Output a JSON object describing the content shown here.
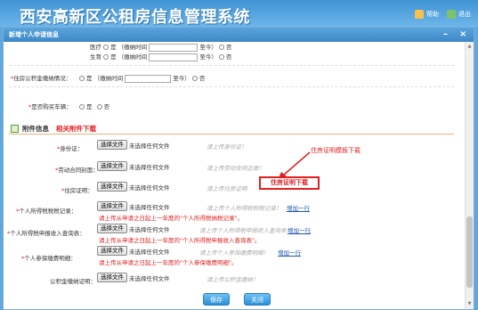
{
  "header": {
    "title": "西安高新区公租房信息管理系统",
    "help": "帮助",
    "logout": "退出"
  },
  "dialog": {
    "title": "新增个人申请信息",
    "minimize": "–",
    "close": "×"
  },
  "top_rows": [
    {
      "label": "医疗",
      "yes": "是",
      "since": "（缴纳时间",
      "until": "至今）",
      "no": "否"
    },
    {
      "label": "生育",
      "yes": "是",
      "since": "（缴纳时间",
      "until": "至今）",
      "no": "否"
    }
  ],
  "housing_fund": {
    "label": "住房公积金缴纳情况：",
    "yes": "是",
    "since": "（缴纳时间",
    "until": "至今）",
    "no": "否"
  },
  "car": {
    "label": "是否购买车辆：",
    "yes": "是",
    "no": "否"
  },
  "attachments": {
    "section_title": "附件信息",
    "download_link": "相关附件下载",
    "choose_file": "选择文件",
    "no_file": "未选择任何文件",
    "add_row": "增加一行",
    "rows": [
      {
        "label": "身份证：",
        "hint": "请上传身份证！"
      },
      {
        "label": "劳动合同封面：",
        "hint": "请上传劳动合同正面！"
      },
      {
        "label": "住房证明：",
        "hint": "请上传住房证明"
      },
      {
        "label": "个人所得税税税记录：",
        "hint": "请上传个人所得税税税记录！",
        "note": "请上传从申请之日起上一年度的\"个人所得税纳税记录\"。"
      },
      {
        "label": "个人所得税申报收入查询表：",
        "hint": "请上传个人所得税申报收入查询表！",
        "note": "请上传从申请之日起上一年度的\"个人所得税申报收入查询表\"。"
      },
      {
        "label": "个人参保缴费明细：",
        "hint": "请上传个人参保缴费明细！",
        "note": "请上传从申请之日起上一年度的\"个人参保缴费明细\"。"
      },
      {
        "label": "公积金缴纳证明：",
        "hint": "请上传公积金缴纳！"
      }
    ]
  },
  "annotation": {
    "callout": "住房证明模板下载",
    "boxed": "住房证明下载"
  },
  "footer": {
    "save": "保存",
    "close": "关闭"
  },
  "colors": {
    "header_blue": "#3f93d4",
    "accent_red": "#e02020",
    "button_blue": "#2b8fd8"
  }
}
